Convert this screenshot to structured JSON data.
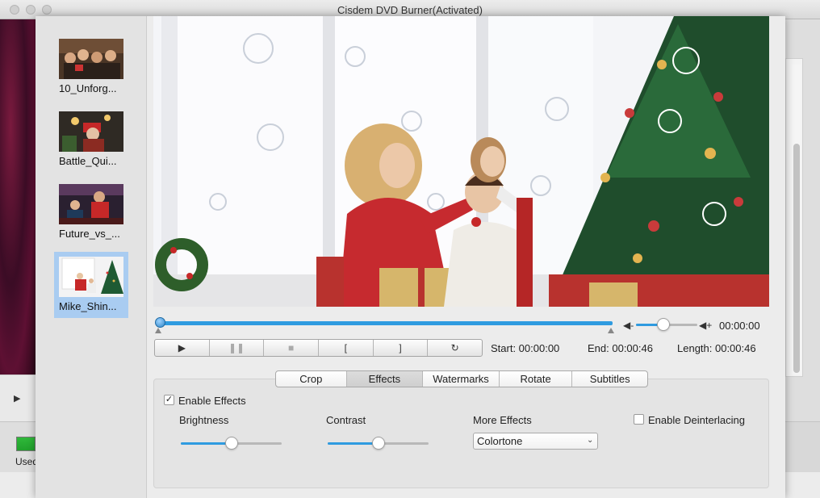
{
  "window": {
    "title": "Cisdem DVD Burner(Activated)"
  },
  "background_app": {
    "used_label": "Used"
  },
  "files": [
    {
      "label": "10_Unforg...",
      "selected": false
    },
    {
      "label": "Battle_Qui...",
      "selected": false
    },
    {
      "label": "Future_vs_...",
      "selected": false
    },
    {
      "label": "Mike_Shin...",
      "selected": true
    }
  ],
  "player": {
    "volume_time": "00:00:00",
    "progress": 0.0,
    "volume_level": 0.45,
    "start_label": "Start: 00:00:00",
    "end_label": "End: 00:00:46",
    "length_label": "Length: 00:00:46",
    "controls": [
      {
        "glyph": "▶",
        "icon": "play-icon",
        "enabled": true
      },
      {
        "glyph": "❚❚",
        "icon": "pause-icon",
        "enabled": false
      },
      {
        "glyph": "■",
        "icon": "stop-icon",
        "enabled": false
      },
      {
        "glyph": "[",
        "icon": "mark-in-icon",
        "enabled": true
      },
      {
        "glyph": "]",
        "icon": "mark-out-icon",
        "enabled": true
      },
      {
        "glyph": "↻",
        "icon": "reset-icon",
        "enabled": true
      }
    ]
  },
  "tabs": [
    {
      "label": "Crop",
      "active": false
    },
    {
      "label": "Effects",
      "active": true
    },
    {
      "label": "Watermarks",
      "active": false
    },
    {
      "label": "Rotate",
      "active": false
    },
    {
      "label": "Subtitles",
      "active": false
    }
  ],
  "effects": {
    "enable_label": "Enable Effects",
    "enable_checked": true,
    "brightness_label": "Brightness",
    "brightness_value": 0.5,
    "contrast_label": "Contrast",
    "contrast_value": 0.5,
    "more_effects_label": "More Effects",
    "more_effects_selected": "Colortone",
    "deinterlace_label": "Enable Deinterlacing",
    "deinterlace_checked": false
  },
  "colors": {
    "accent": "#2f9be0",
    "selection": "#a9ccf1"
  }
}
